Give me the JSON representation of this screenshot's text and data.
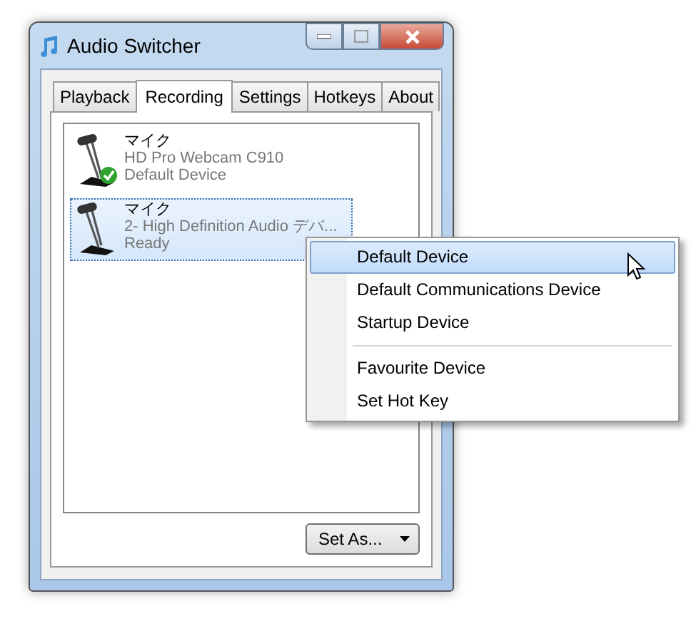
{
  "window": {
    "title": "Audio Switcher"
  },
  "tabs": [
    {
      "label": "Playback",
      "selected": false
    },
    {
      "label": "Recording",
      "selected": true
    },
    {
      "label": "Settings",
      "selected": false
    },
    {
      "label": "Hotkeys",
      "selected": false
    },
    {
      "label": "About",
      "selected": false
    }
  ],
  "devices": [
    {
      "name": "マイク",
      "description": "HD Pro Webcam C910",
      "status": "Default Device",
      "is_default": true,
      "selected": false
    },
    {
      "name": "マイク",
      "description": "2- High Definition Audio デバ...",
      "status": "Ready",
      "is_default": false,
      "selected": true
    }
  ],
  "set_as_button": {
    "label": "Set As..."
  },
  "context_menu": {
    "groups": [
      [
        {
          "label": "Default Device",
          "selected": true
        },
        {
          "label": "Default Communications Device",
          "selected": false
        },
        {
          "label": "Startup Device",
          "selected": false
        }
      ],
      [
        {
          "label": "Favourite Device",
          "selected": false
        },
        {
          "label": "Set Hot Key",
          "selected": false
        }
      ]
    ]
  }
}
